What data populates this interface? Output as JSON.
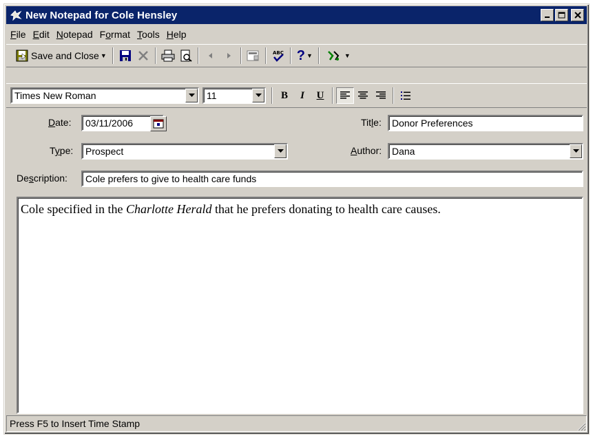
{
  "window": {
    "title": "New Notepad for Cole Hensley",
    "controls": {
      "minimize": "_",
      "maximize": "□",
      "close": "×"
    }
  },
  "menu": {
    "items": [
      {
        "label": "File",
        "accel_index": 0
      },
      {
        "label": "Edit",
        "accel_index": 0
      },
      {
        "label": "Notepad",
        "accel_index": 0
      },
      {
        "label": "Format",
        "accel_index": 1
      },
      {
        "label": "Tools",
        "accel_index": 0
      },
      {
        "label": "Help",
        "accel_index": 0
      }
    ]
  },
  "toolbar": {
    "save_close_label": "Save and Close",
    "help_label": "?"
  },
  "format_toolbar": {
    "font_name": "Times New Roman",
    "font_size": "11",
    "bold": "B",
    "italic": "I",
    "underline": "U"
  },
  "form": {
    "date_label": "Date:",
    "date_value": "03/11/2006",
    "title_label": "Title:",
    "title_value": "Donor Preferences",
    "type_label": "Type:",
    "type_value": "Prospect",
    "author_label": "Author:",
    "author_value": "Dana",
    "description_label": "Description:",
    "description_value": "Cole prefers to give to health care funds"
  },
  "editor": {
    "text_before": "Cole specified in the ",
    "text_italic": "Charlotte Herald",
    "text_after": " that he prefers donating to health care causes."
  },
  "statusbar": {
    "text": "Press F5 to Insert Time Stamp"
  },
  "colors": {
    "titlebar": "#0a246a",
    "face": "#d4d0c8",
    "shadow": "#808080",
    "highlight": "#ffffff"
  },
  "icons": [
    "notepad-app-icon",
    "save-close-icon",
    "save-icon",
    "delete-icon",
    "print-icon",
    "print-preview-icon",
    "previous-icon",
    "next-icon",
    "properties-icon",
    "spell-check-icon",
    "help-icon",
    "tools-icon",
    "calendar-icon",
    "align-left-icon",
    "align-center-icon",
    "align-right-icon",
    "bullets-icon"
  ]
}
